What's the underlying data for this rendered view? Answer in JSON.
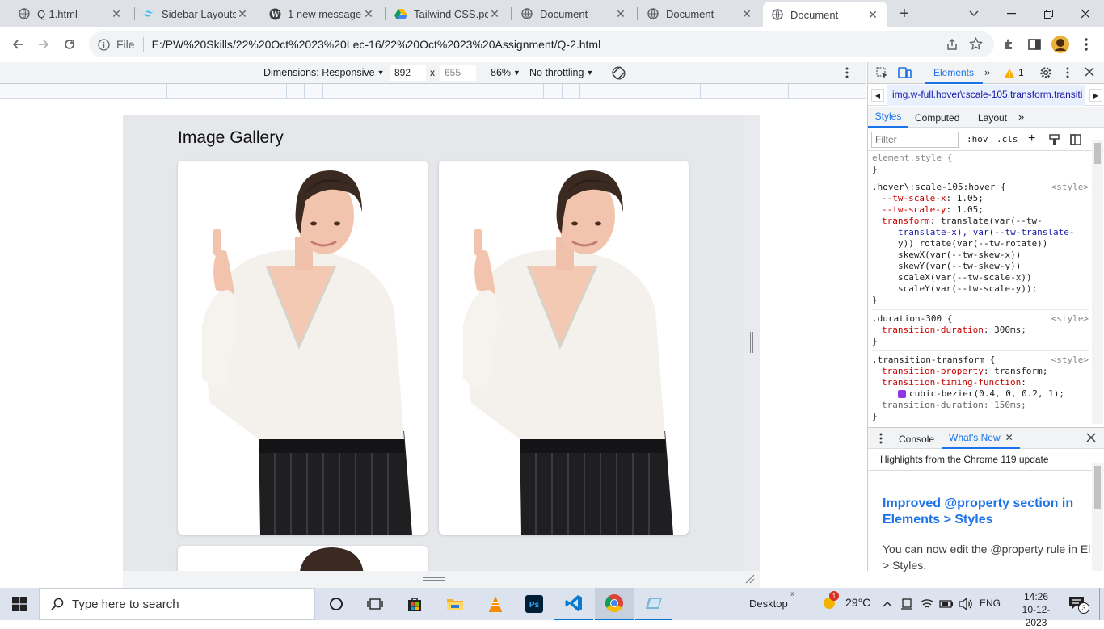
{
  "tabs": [
    {
      "title": "Q-1.html"
    },
    {
      "title": "Sidebar Layouts"
    },
    {
      "title": "1 new message"
    },
    {
      "title": "Tailwind CSS.pdf"
    },
    {
      "title": "Document"
    },
    {
      "title": "Document"
    },
    {
      "title": "Document"
    }
  ],
  "address": {
    "scheme_label": "File",
    "url": "E:/PW%20Skills/22%20Oct%2023%20Lec-16/22%20Oct%2023%20Assignment/Q-2.html"
  },
  "device_toolbar": {
    "dimensions_label": "Dimensions: Responsive",
    "width": "892",
    "times": "x",
    "height": "655",
    "zoom": "86%",
    "throttling": "No throttling"
  },
  "page": {
    "heading": "Image Gallery"
  },
  "devtools": {
    "tabs": {
      "elements": "Elements",
      "warning_count": "1"
    },
    "breadcrumb": "img.w-full.hover\\:scale-105.transform.transiti",
    "subtabs": {
      "styles": "Styles",
      "computed": "Computed",
      "layout": "Layout"
    },
    "filter_placeholder": "Filter",
    "hov": ":hov",
    "cls": ".cls",
    "style_tag": "<style>",
    "rules": {
      "element_style": "element.style {",
      "close": "}",
      "r1_selector": ".hover\\:scale-105:hover {",
      "r1_p1": "--tw-scale-x",
      "r1_v1": ": 1.05;",
      "r1_p2": "--tw-scale-y",
      "r1_v2": ": 1.05;",
      "r1_p3": "transform",
      "r1_v3a": ": translate(var(--tw-",
      "r1_v3b": "translate-x), var(--tw-translate-",
      "r1_v3c": "y)) rotate(var(--tw-rotate))",
      "r1_v3d": "skewX(var(--tw-skew-x))",
      "r1_v3e": "skewY(var(--tw-skew-y))",
      "r1_v3f": "scaleX(var(--tw-scale-x))",
      "r1_v3g": "scaleY(var(--tw-scale-y));",
      "r2_selector": ".duration-300 {",
      "r2_p1": "transition-duration",
      "r2_v1": ": 300ms;",
      "r3_selector": ".transition-transform {",
      "r3_p1": "transition-property",
      "r3_v1": ": transform;",
      "r3_p2": "transition-timing-function",
      "r3_v2": ":",
      "r3_v2b": "cubic-bezier(0.4, 0, 0.2, 1);",
      "r3_p3": "transition-duration: 150ms;"
    },
    "drawer": {
      "console": "Console",
      "whats_new": "What's New",
      "highlights": "Highlights from the Chrome 119 update",
      "article_title": "Improved @property section in Elements > Styles",
      "article_body": "You can now edit the @property rule in El > Styles."
    }
  },
  "taskbar": {
    "search_placeholder": "Type here to search",
    "desktop": "Desktop",
    "weather": "29°C",
    "language": "ENG",
    "time": "14:26",
    "date": "10-12-2023",
    "notif_count": "3",
    "weather_badge": "1"
  },
  "colors": {
    "accent": "#1a73e8",
    "page_bg": "#e5e7eb",
    "taskbar": "#dde3ee"
  }
}
